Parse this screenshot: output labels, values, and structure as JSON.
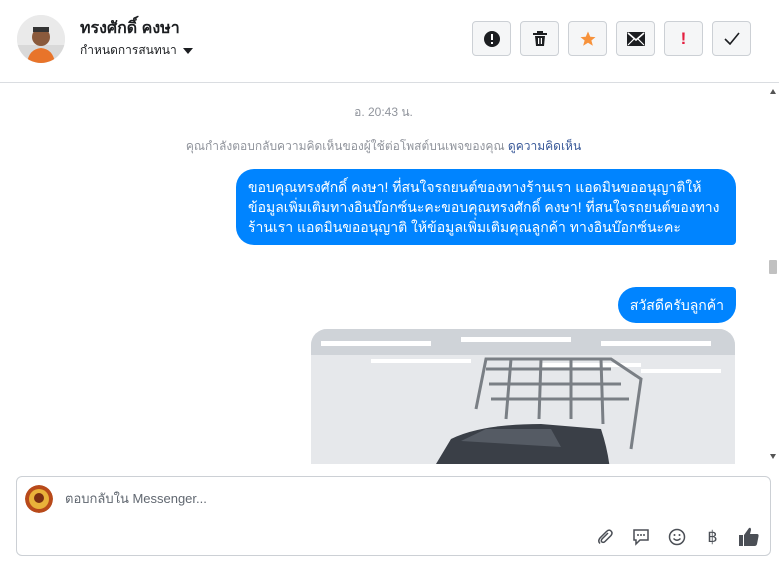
{
  "header": {
    "contact_name": "ทรงศักดิ์ คงษา",
    "assign_label": "กำหนดการสนทนา",
    "actions": [
      {
        "icon": "alert-circle-icon"
      },
      {
        "icon": "trash-icon"
      },
      {
        "icon": "star-icon"
      },
      {
        "icon": "envelope-icon"
      },
      {
        "icon": "exclamation-icon",
        "label": "!"
      },
      {
        "icon": "checkmark-icon"
      }
    ]
  },
  "thread": {
    "timestamp": "อ. 20:43 น.",
    "context_text": "คุณกำลังตอบกลับความคิดเห็นของผู้ใช้ต่อโพสต์บนเพจของคุณ",
    "context_link": "ดูความคิดเห็น",
    "messages": [
      {
        "text": "ขอบคุณทรงศักดิ์ คงษา! ที่สนใจรถยนต์ของทางร้านเรา แอดมินขออนุญาติให้ข้อมูลเพิ่มเติมทางอินบ๊อกซ์นะคะขอบคุณทรงศักดิ์ คงษา! ที่สนใจรถยนต์ของทางร้านเรา แอดมินขออนุญาติ ให้ข้อมูลเพิ่มเติมคุณลูกค้า ทางอินบ๊อกซ์นะคะ"
      },
      {
        "text": "สวัสดีครับลูกค้า"
      }
    ]
  },
  "composer": {
    "placeholder": "ตอบกลับใน Messenger...",
    "tools": [
      "paperclip-icon",
      "comment-icon",
      "smiley-icon",
      "baht-icon",
      "thumbs-up-icon"
    ],
    "baht_symbol": "฿"
  },
  "colors": {
    "bubble": "#0084ff",
    "star": "#f7923b",
    "alert": "#e41e3f"
  }
}
